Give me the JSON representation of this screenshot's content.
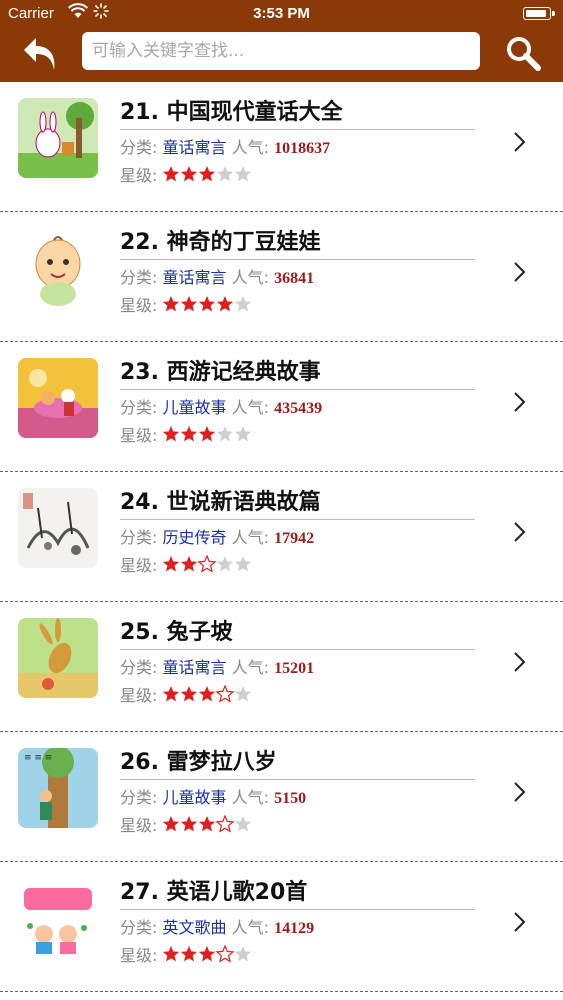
{
  "status_bar": {
    "carrier": "Carrier",
    "time": "3:53 PM"
  },
  "nav": {
    "back_icon": "back-arrow-icon",
    "search_placeholder": "可输入关键字查找...",
    "search_icon": "magnifier-icon"
  },
  "colors": {
    "header_bg": "#8B3A07",
    "category": "#1b2fa8",
    "popularity": "#9b1b1b",
    "star_on": "#e01e1e",
    "star_off": "#cfcfcf"
  },
  "labels": {
    "category": "分类:",
    "popularity": "人气:",
    "rating": "星级:"
  },
  "items": [
    {
      "title": "21. 中国现代童话大全",
      "category": "童话寓言",
      "popularity": "1018637",
      "rating": 3,
      "thumb": "rabbit-cartoon"
    },
    {
      "title": "22. 神奇的丁豆娃娃",
      "category": "童话寓言",
      "popularity": "36841",
      "rating": 4,
      "thumb": "baby-cartoon"
    },
    {
      "title": "23. 西游记经典故事",
      "category": "儿童故事",
      "popularity": "435439",
      "rating": 3,
      "thumb": "journey-west"
    },
    {
      "title": "24. 世说新语典故篇",
      "category": "历史传奇",
      "popularity": "17942",
      "rating": 2.5,
      "thumb": "ink-painting"
    },
    {
      "title": "25. 兔子坡",
      "category": "童话寓言",
      "popularity": "15201",
      "rating": 3.5,
      "thumb": "rabbit-hill"
    },
    {
      "title": "26. 雷梦拉八岁",
      "category": "儿童故事",
      "popularity": "5150",
      "rating": 3.5,
      "thumb": "girl-tree"
    },
    {
      "title": "27. 英语儿歌20首",
      "category": "英文歌曲",
      "popularity": "14129",
      "rating": 3.5,
      "thumb": "english-songs"
    }
  ]
}
